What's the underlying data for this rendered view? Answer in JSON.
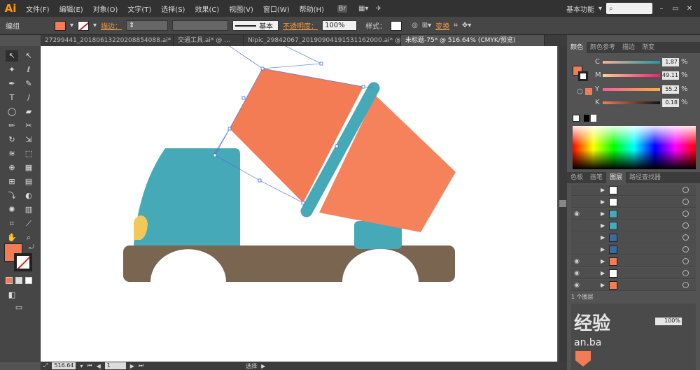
{
  "app": {
    "logo": "Ai"
  },
  "menu": [
    "文件(F)",
    "编辑(E)",
    "对象(O)",
    "文字(T)",
    "选择(S)",
    "效果(C)",
    "视图(V)",
    "窗口(W)",
    "帮助(H)"
  ],
  "workspace": "基本功能",
  "control": {
    "selection": "编组",
    "stroke_label": "描边：",
    "brush_label": "基本",
    "opacity_label": "不透明度：",
    "opacity_value": "100%",
    "style_label": "样式：",
    "transform_label": "变换"
  },
  "tabs": [
    "27299441_20180613220208854088.ai* @ ...",
    "交通工具.ai* @ ...",
    "Nipic_29842067_20190904191531162000.ai* @ ...",
    "未标题-75* @ 516.64% (CMYK/预览)"
  ],
  "status": {
    "zoom": "516.64",
    "page": "1",
    "tool": "选择"
  },
  "color_panel": {
    "tabs": [
      "颜色",
      "颜色参考",
      "描边",
      "渐变"
    ],
    "sliders": [
      {
        "label": "C",
        "value": "1.87"
      },
      {
        "label": "M",
        "value": "49.11"
      },
      {
        "label": "Y",
        "value": "55.2"
      },
      {
        "label": "K",
        "value": "0.18"
      }
    ],
    "unit": "%"
  },
  "layers_panel": {
    "tabs": [
      "色板",
      "画笔",
      "图层",
      "路径查找器"
    ],
    "rows": 9,
    "footer": "1 个图层"
  },
  "colors": {
    "fill": "#f47c54",
    "truck_teal": "#45a9b8",
    "drum_orange": "#f47c54",
    "drum_orange_light": "#f5825a",
    "base_brown": "#7a6550",
    "light_yellow": "#f2c85b",
    "selection_blue": "#4a6fd8"
  },
  "watermark": {
    "text": "经验",
    "subtext": "an.ba"
  }
}
